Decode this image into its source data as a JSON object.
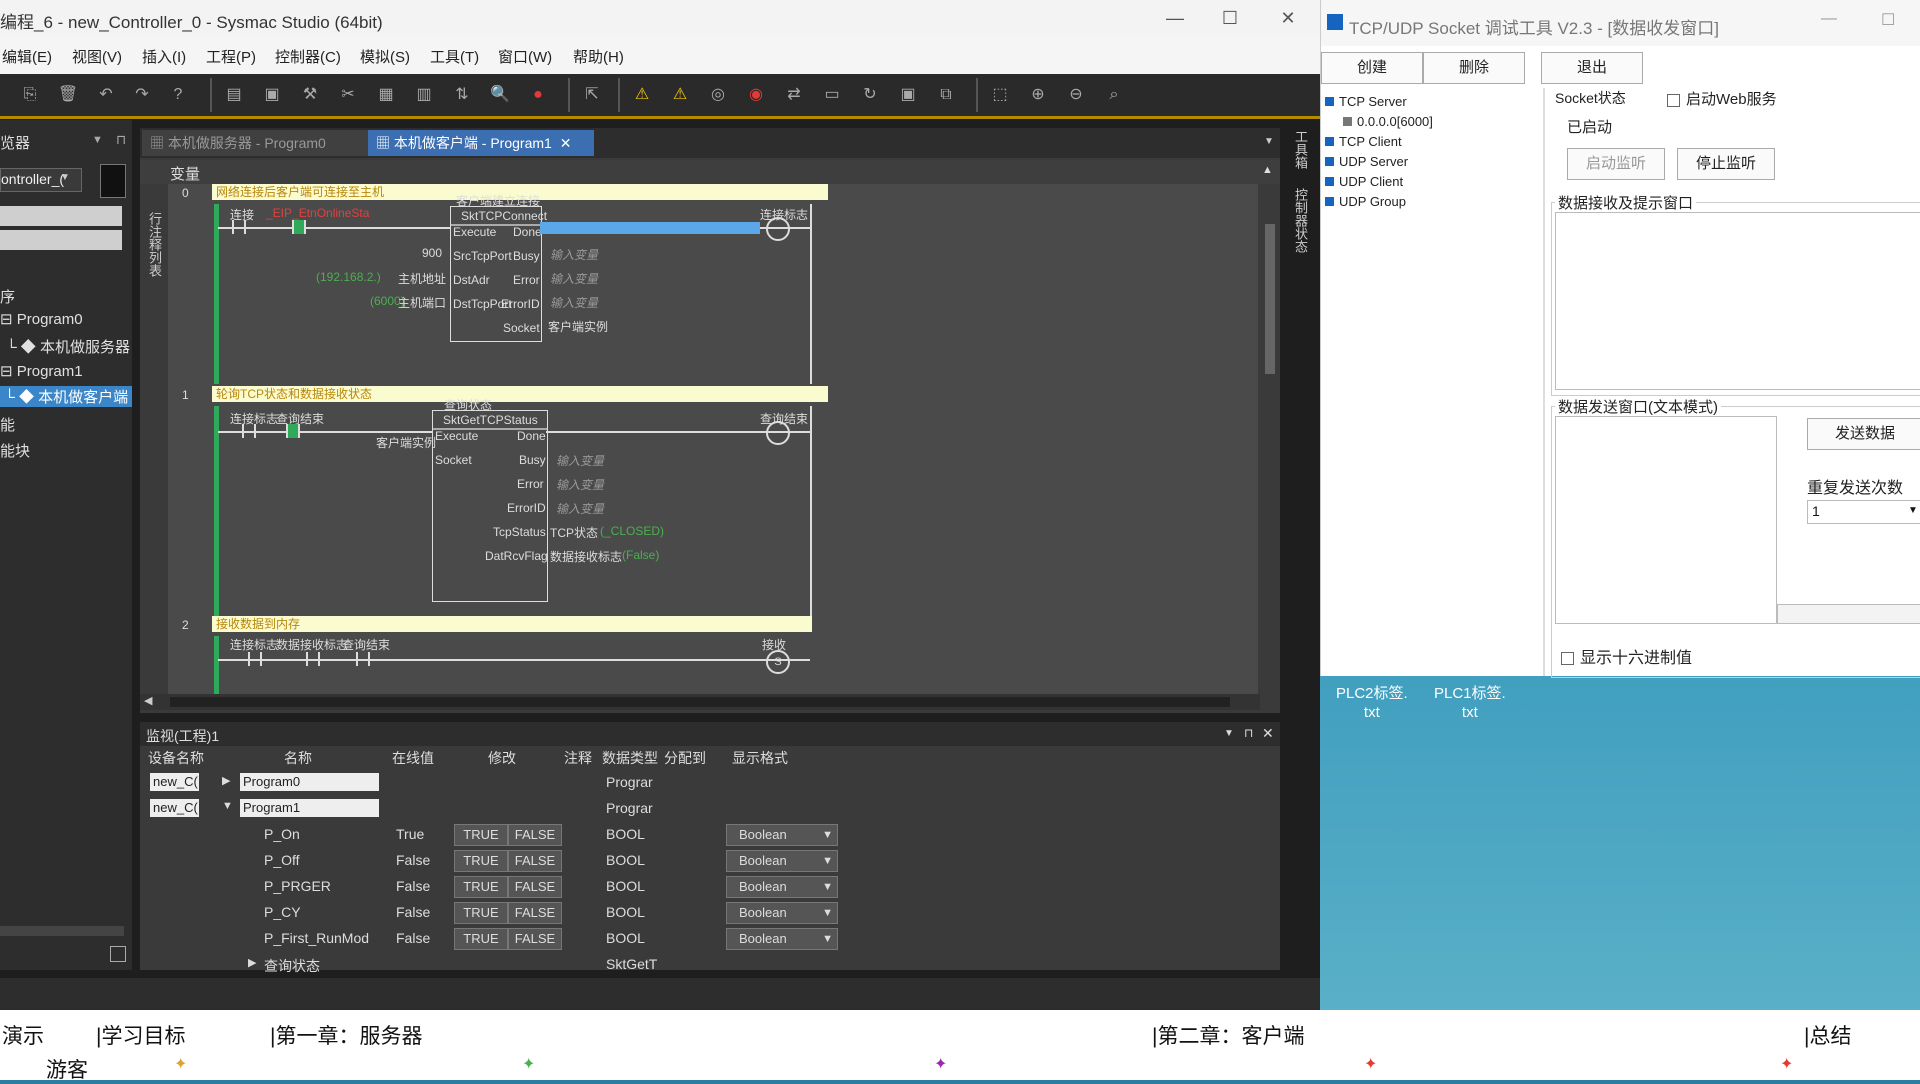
{
  "sysmac": {
    "title": "编程_6 - new_Controller_0 - Sysmac Studio (64bit)",
    "menu": [
      "编辑(E)",
      "视图(V)",
      "插入(I)",
      "工程(P)",
      "控制器(C)",
      "模拟(S)",
      "工具(T)",
      "窗口(W)",
      "帮助(H)"
    ],
    "explorer": {
      "header": "览器",
      "controller": "ontroller_(",
      "items": [
        "序",
        "Program0",
        "本机做服务器",
        "Program1",
        "本机做客户端",
        "能",
        "能块"
      ]
    },
    "tabs": [
      "本机做服务器 - Program0",
      "本机做客户端 - Program1"
    ],
    "var_label": "变量",
    "side_tab_left": "行注释列表",
    "side_tabs_right": [
      "工具箱",
      "控制器状态"
    ],
    "ladder": {
      "rung0": {
        "number": "0",
        "comment": "网络连接后客户端可连接至主机",
        "contact1": "连接",
        "contact2": "_EIP_EtnOnlineSta",
        "fb_title": "客户端建立连接",
        "fb_name": "SktTCPConnect",
        "in_execute": "Execute",
        "out_done": "Done",
        "coil": "连接标志",
        "in_srcport_val": "900",
        "in_srcport": "SrcTcpPort",
        "in_dstadr_val": "(192.168.2.)",
        "in_dstadr_var": "主机地址",
        "in_dstadr": "DstAdr",
        "in_dstport_val": "(6000)",
        "in_dstport_var": "主机端口",
        "in_dstport": "DstTcpPort",
        "out_busy": "Busy",
        "out_error": "Error",
        "out_errorid": "ErrorID",
        "out_socket": "Socket",
        "out_socket_var": "客户端实例",
        "placeholder": "输入变量"
      },
      "rung1": {
        "number": "1",
        "comment": "轮询TCP状态和数据接收状态",
        "contact1": "连接标志",
        "contact2": "查询结束",
        "fb_title": "查询状态",
        "fb_name": "SktGetTCPStatus",
        "in_execute": "Execute",
        "out_done": "Done",
        "coil": "查询结束",
        "in_socket_var": "客户端实例",
        "in_socket": "Socket",
        "out_busy": "Busy",
        "out_error": "Error",
        "out_errorid": "ErrorID",
        "out_tcpstatus": "TcpStatus",
        "out_tcpstatus_var": "TCP状态",
        "out_tcpstatus_val": "(_CLOSED)",
        "out_datrcv": "DatRcvFlag",
        "out_datrcv_var": "数据接收标志",
        "out_datrcv_val": "(False)",
        "placeholder": "输入变量"
      },
      "rung2": {
        "number": "2",
        "comment": "接收数据到内存",
        "contact1": "连接标志",
        "contact2": "数据接收标志",
        "contact3": "查询结束",
        "coil": "接收",
        "coil_mark": "S"
      }
    },
    "watch": {
      "title": "监视(工程)1",
      "columns": [
        "设备名称",
        "名称",
        "在线值",
        "修改",
        "注释",
        "数据类型",
        "分配到",
        "显示格式"
      ],
      "groups": [
        {
          "device": "new_C(",
          "name": "Program0",
          "type": "Prograr",
          "expander": "▶"
        },
        {
          "device": "new_C(",
          "name": "Program1",
          "type": "Prograr",
          "expander": "▼"
        }
      ],
      "rows": [
        {
          "name": "P_On",
          "value": "True",
          "t": "TRUE",
          "f": "FALSE",
          "type": "BOOL",
          "format": "Boolean"
        },
        {
          "name": "P_Off",
          "value": "False",
          "t": "TRUE",
          "f": "FALSE",
          "type": "BOOL",
          "format": "Boolean"
        },
        {
          "name": "P_PRGER",
          "value": "False",
          "t": "TRUE",
          "f": "FALSE",
          "type": "BOOL",
          "format": "Boolean"
        },
        {
          "name": "P_CY",
          "value": "False",
          "t": "TRUE",
          "f": "FALSE",
          "type": "BOOL",
          "format": "Boolean"
        },
        {
          "name": "P_First_RunMod",
          "value": "False",
          "t": "TRUE",
          "f": "FALSE",
          "type": "BOOL",
          "format": "Boolean"
        }
      ],
      "last_row": {
        "name": "查询状态",
        "type": "SktGetT"
      }
    }
  },
  "tcp_tool": {
    "title": "TCP/UDP Socket 调试工具 V2.3 - [数据收发窗口]",
    "buttons": {
      "create": "创建",
      "delete": "删除",
      "exit": "退出"
    },
    "tree": [
      "TCP Server",
      "0.0.0.0[6000]",
      "TCP Client",
      "UDP Server",
      "UDP Client",
      "UDP Group"
    ],
    "socket_status_label": "Socket状态",
    "web_service": "启动Web服务",
    "status_text": "已启动",
    "start_listen": "启动监听",
    "stop_listen": "停止监听",
    "recv_group": "数据接收及提示窗口",
    "send_group": "数据发送窗口(文本模式)",
    "send_button": "发送数据",
    "repeat_label": "重复发送次数",
    "repeat_value": "1",
    "hex_label": "显示十六进制值"
  },
  "desktop_icons": [
    {
      "line1": "PLC2标签.",
      "line2": "txt"
    },
    {
      "line1": "PLC1标签.",
      "line2": "txt"
    }
  ],
  "chapters": [
    "演示",
    "|学习目标",
    "|第一章：服务器",
    "|第二章：客户端",
    "|总结"
  ],
  "guest": "游客",
  "colors": {
    "accent": "#3c6fb2",
    "rail": "#2faa5a",
    "chapter_rule": "#e53935"
  }
}
